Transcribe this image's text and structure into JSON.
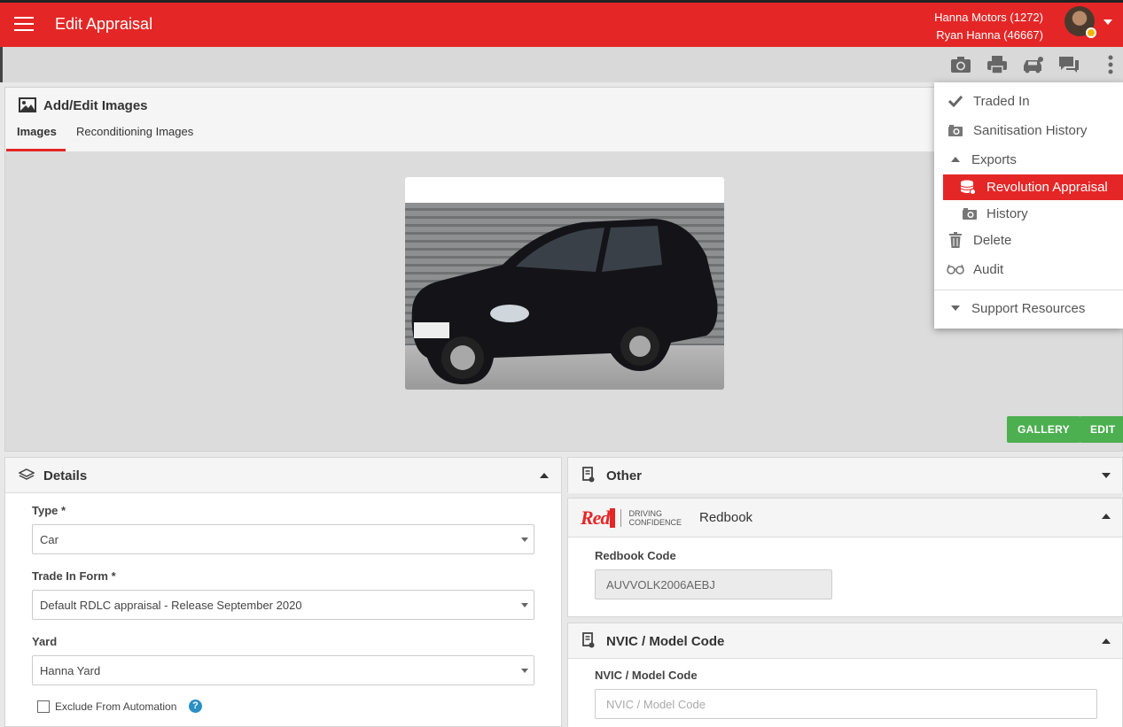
{
  "header": {
    "title": "Edit Appraisal",
    "dealer": "Hanna Motors (1272)",
    "user": "Ryan Hanna (46667)"
  },
  "toolbar": {
    "icons": [
      "camera-icon",
      "print-icon",
      "car-icon",
      "chat-icon",
      "more-vert-icon"
    ]
  },
  "images": {
    "title": "Add/Edit Images",
    "tabs": [
      "Images",
      "Reconditioning Images"
    ],
    "gallery_button": "GALLERY",
    "edit_button": "EDIT"
  },
  "menu": {
    "items": [
      {
        "label": "Traded In",
        "icon": "check-icon"
      },
      {
        "label": "Sanitisation History",
        "icon": "camera-history-icon"
      },
      {
        "label": "Exports",
        "icon": "caret-up-icon"
      },
      {
        "label": "Revolution Appraisal",
        "icon": "database-icon"
      },
      {
        "label": "History",
        "icon": "camera-history-icon"
      },
      {
        "label": "Delete",
        "icon": "trash-icon"
      },
      {
        "label": "Audit",
        "icon": "glasses-icon"
      },
      {
        "label": "Support Resources",
        "icon": "caret-down-icon"
      }
    ],
    "active_color": "#e42726"
  },
  "details": {
    "title": "Details",
    "type_label": "Type *",
    "type_value": "Car",
    "form_label": "Trade In Form *",
    "form_value": "Default RDLC appraisal - Release September 2020",
    "yard_label": "Yard",
    "yard_value": "Hanna Yard",
    "exclude_label": "Exclude From Automation",
    "help": "?"
  },
  "other": {
    "title": "Other"
  },
  "redbook": {
    "title": "Redbook",
    "logo_red": "Red",
    "logo_book": "BOOK",
    "logo_tag1": "DRIVING",
    "logo_tag2": "CONFIDENCE",
    "code_label": "Redbook Code",
    "code_value": "AUVVOLK2006AEBJ"
  },
  "nvic": {
    "title": "NVIC / Model Code",
    "label": "NVIC / Model Code",
    "placeholder": "NVIC / Model Code"
  },
  "colors": {
    "brand": "#e42726",
    "green": "#4caf50"
  }
}
